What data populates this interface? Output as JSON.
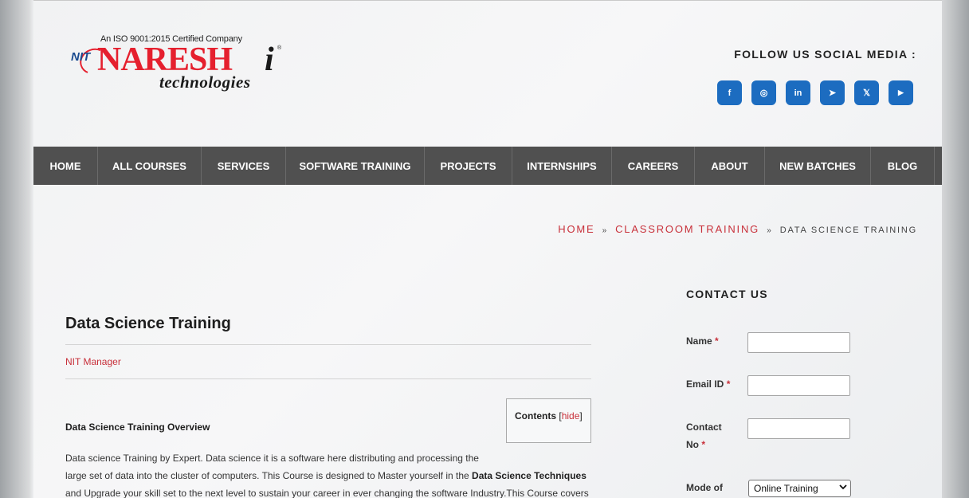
{
  "header": {
    "logo": {
      "iso_text": "An ISO 9001:2015 Certified Company",
      "nit": "NIT",
      "name": "NARESH",
      "i": "i",
      "reg": "®",
      "tagline": "technologies"
    },
    "follow_label": "FOLLOW US SOCIAL MEDIA :",
    "socials": [
      {
        "icon": "facebook-icon",
        "glyph": "f"
      },
      {
        "icon": "instagram-icon",
        "glyph": "◎"
      },
      {
        "icon": "linkedin-icon",
        "glyph": "in"
      },
      {
        "icon": "telegram-icon",
        "glyph": "➤"
      },
      {
        "icon": "x-twitter-icon",
        "glyph": "𝕏"
      },
      {
        "icon": "youtube-icon",
        "glyph": "▶"
      }
    ],
    "social_color": "#1c6cc0"
  },
  "nav": {
    "items": [
      "HOME",
      "ALL COURSES",
      "SERVICES",
      "SOFTWARE TRAINING",
      "PROJECTS",
      "INTERNSHIPS",
      "CAREERS",
      "ABOUT",
      "NEW BATCHES",
      "BLOG"
    ]
  },
  "breadcrumb": {
    "home": "HOME",
    "sep": "»",
    "category": "CLASSROOM TRAINING",
    "current": "DATA SCIENCE TRAINING"
  },
  "article": {
    "title": "Data Science Training",
    "author": "NIT Manager",
    "toc_label": "Contents",
    "toc_open": "[",
    "toc_toggle": "hide",
    "toc_close": "]",
    "overview_heading": "Data Science Training Overview",
    "para_1": "Data science Training by Expert. Data science it is a software here distributing and processing the",
    "para_2": "large set of data into the cluster of computers. This Course is designed to Master yourself in the ",
    "para_2_bold": "Data Science Techniques",
    "para_3": "and Upgrade your skill set to the next level to sustain your career in ever changing the software Industry.This Course covers"
  },
  "contact": {
    "title": "CONTACT US",
    "name_label": "Name",
    "email_label": "Email ID",
    "contact_label_1": "Contact",
    "contact_label_2": "No",
    "req": "*",
    "mode_label": "Mode of",
    "mode_value": "Online Training"
  },
  "colors": {
    "accent_red": "#c8303a",
    "nav_bg": "#505050"
  }
}
